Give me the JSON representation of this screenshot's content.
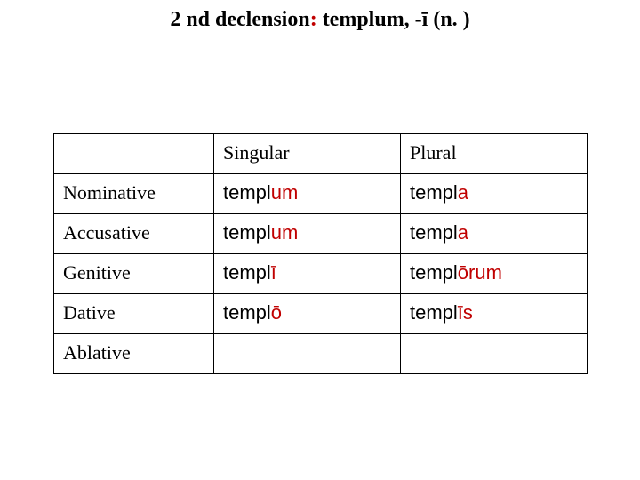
{
  "title": {
    "part_a": "2 nd declension",
    "colon": ":",
    "part_b": " templum, -ī (n. )"
  },
  "headers": {
    "blank": "",
    "singular": "Singular",
    "plural": "Plural"
  },
  "rows": [
    {
      "case": "Nominative",
      "sg_stem": "templ",
      "sg_end": "um",
      "pl_stem": "templ",
      "pl_end": "a"
    },
    {
      "case": "Accusative",
      "sg_stem": "templ",
      "sg_end": "um",
      "pl_stem": "templ",
      "pl_end": "a"
    },
    {
      "case": "Genitive",
      "sg_stem": "templ",
      "sg_end": "ī",
      "pl_stem": "templ",
      "pl_end": "ōrum"
    },
    {
      "case": "Dative",
      "sg_stem": "templ",
      "sg_end": "ō",
      "pl_stem": "templ",
      "pl_end": "īs"
    },
    {
      "case": "Ablative",
      "sg_stem": "",
      "sg_end": "",
      "pl_stem": "",
      "pl_end": ""
    }
  ]
}
